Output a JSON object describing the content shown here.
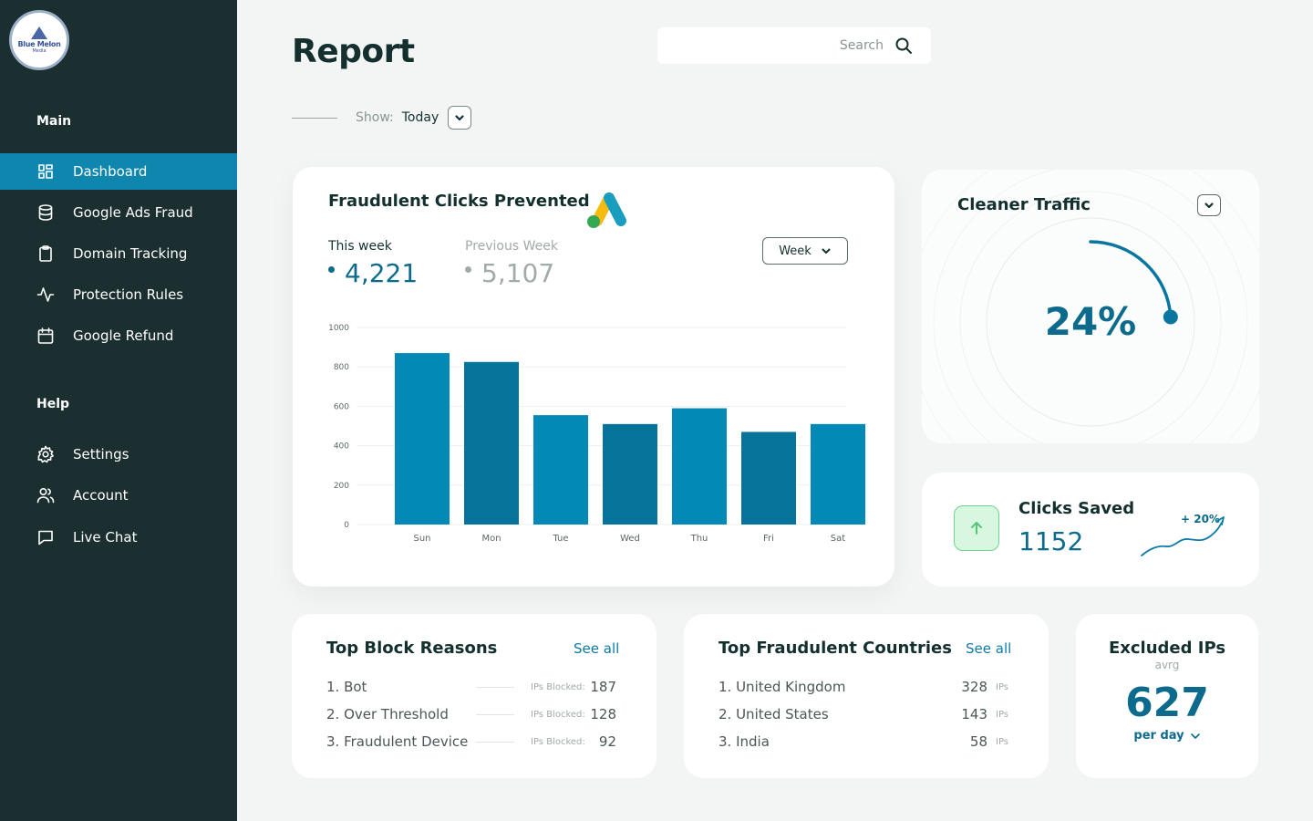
{
  "brand": {
    "line1": "Blue Melon",
    "line2": "Media"
  },
  "sidebar": {
    "main_title": "Main",
    "help_title": "Help",
    "main_items": [
      {
        "label": "Dashboard",
        "icon": "grid-icon",
        "active": true
      },
      {
        "label": "Google Ads Fraud",
        "icon": "database-icon"
      },
      {
        "label": "Domain Tracking",
        "icon": "clipboard-icon"
      },
      {
        "label": "Protection Rules",
        "icon": "activity-icon"
      },
      {
        "label": "Google Refund",
        "icon": "calendar-icon"
      }
    ],
    "help_items": [
      {
        "label": "Settings",
        "icon": "gear-icon"
      },
      {
        "label": "Account",
        "icon": "users-icon"
      },
      {
        "label": "Live Chat",
        "icon": "chat-icon"
      }
    ]
  },
  "header": {
    "title": "Report",
    "search_placeholder": "Search",
    "show_label": "Show:",
    "show_value": "Today"
  },
  "fraud_card": {
    "title": "Fraudulent Clicks Prevented",
    "this_week_label": "This week",
    "this_week_value": "4,221",
    "prev_week_label": "Previous Week",
    "prev_week_value": "5,107",
    "period_select": "Week"
  },
  "chart_data": {
    "type": "bar",
    "categories": [
      "Sun",
      "Mon",
      "Tue",
      "Wed",
      "Thu",
      "Fri",
      "Sat"
    ],
    "values": [
      870,
      825,
      555,
      510,
      590,
      470,
      510
    ],
    "ylim": [
      0,
      1000
    ],
    "yticks": [
      0,
      200,
      400,
      600,
      800,
      1000
    ],
    "colors": [
      "#0389b5",
      "#06739a"
    ],
    "grid": true
  },
  "cleaner": {
    "title": "Cleaner Traffic",
    "percent_text": "24%",
    "percent": 24
  },
  "saved": {
    "title": "Clicks Saved",
    "value": "1152",
    "trend": "+ 20%"
  },
  "blocks": {
    "title": "Top Block Reasons",
    "see_all": "See all",
    "rows": [
      {
        "name": "1. Bot",
        "label": "IPs Blocked:",
        "value": "187"
      },
      {
        "name": "2. Over Threshold",
        "label": "IPs Blocked:",
        "value": "128"
      },
      {
        "name": "3. Fraudulent Device",
        "label": "IPs Blocked:",
        "value": "92"
      }
    ]
  },
  "countries": {
    "title": "Top Fraudulent Countries",
    "see_all": "See all",
    "rows": [
      {
        "name": "1. United Kingdom",
        "value": "328",
        "unit": "IPs"
      },
      {
        "name": "2. United States",
        "value": "143",
        "unit": "IPs"
      },
      {
        "name": "3. India",
        "value": "58",
        "unit": "IPs"
      }
    ]
  },
  "excluded": {
    "title": "Excluded IPs",
    "subtitle": "avrg",
    "value": "627",
    "period": "per day"
  },
  "colors": {
    "sidebar_bg": "#1b2e30",
    "accent": "#0e86ae",
    "value": "#0c6a8c",
    "green": "#58c479"
  }
}
